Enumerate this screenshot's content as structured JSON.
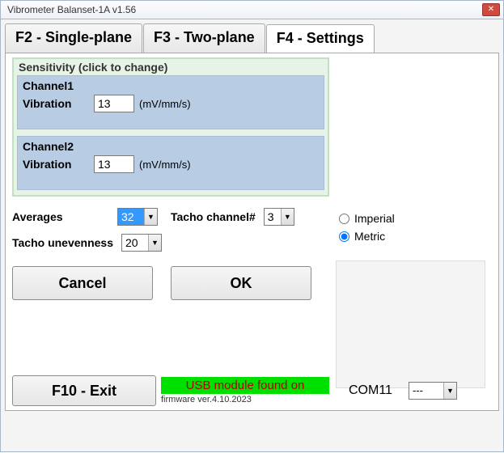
{
  "window": {
    "title": "Vibrometer Balanset-1A  v1.56"
  },
  "tabs": {
    "single": "F2 - Single-plane",
    "two": "F3 - Two-plane",
    "settings": "F4 - Settings"
  },
  "sensitivity": {
    "legend": "Sensitivity (click to change)",
    "ch1": {
      "label": "Channel1",
      "vibLabel": "Vibration",
      "value": "13",
      "unit": "(mV/mm/s)"
    },
    "ch2": {
      "label": "Channel2",
      "vibLabel": "Vibration",
      "value": "13",
      "unit": "(mV/mm/s)"
    }
  },
  "controls": {
    "averagesLabel": "Averages",
    "averagesValue": "32",
    "tachoChLabel": "Tacho channel#",
    "tachoChValue": "3",
    "tachoUnLabel": "Tacho unevenness",
    "tachoUnValue": "20"
  },
  "units": {
    "imperial": "Imperial",
    "metric": "Metric",
    "selected": "metric"
  },
  "buttons": {
    "cancel": "Cancel",
    "ok": "OK",
    "exit": "F10 - Exit"
  },
  "status": {
    "usb": "USB module found on",
    "firmware": "firmware ver.4.10.2023",
    "port": "COM11",
    "portSelect": "---"
  }
}
